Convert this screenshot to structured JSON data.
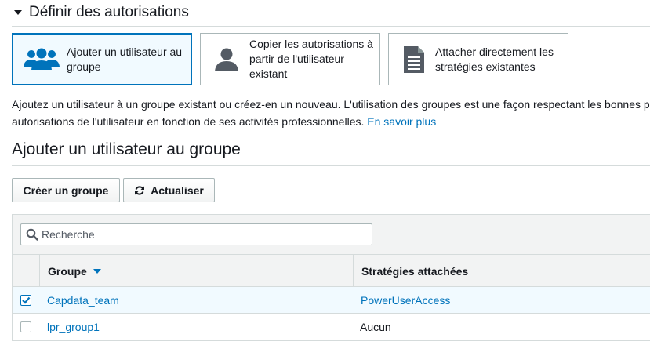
{
  "section": {
    "title": "Définir des autorisations"
  },
  "options": [
    {
      "label": "Ajouter un utilisateur au groupe",
      "icon": "users-group-icon",
      "selected": true
    },
    {
      "label": "Copier les autorisations à partir de l'utilisateur existant",
      "icon": "user-icon",
      "selected": false
    },
    {
      "label": "Attacher directement les stratégies existantes",
      "icon": "document-icon",
      "selected": false
    }
  ],
  "description": {
    "line1": "Ajoutez un utilisateur à un groupe existant ou créez-en un nouveau. L'utilisation des groupes est une façon respectant les bonnes p",
    "line2": "autorisations de l'utilisateur en fonction de ses activités professionnelles.",
    "link": "En savoir plus"
  },
  "subsection": {
    "title": "Ajouter un utilisateur au groupe"
  },
  "buttons": {
    "create": "Créer un groupe",
    "refresh": "Actualiser"
  },
  "search": {
    "placeholder": "Recherche",
    "value": ""
  },
  "table": {
    "headers": {
      "group": "Groupe",
      "policies": "Stratégies attachées"
    },
    "rows": [
      {
        "group": "Capdata_team",
        "policies": "PowerUserAccess",
        "checked": true
      },
      {
        "group": "lpr_group1",
        "policies": "Aucun",
        "checked": false
      }
    ]
  },
  "colors": {
    "accent": "#0073bb",
    "border": "#aab7b8",
    "header_bg": "#f2f3f3",
    "selected_bg": "#f1faff"
  }
}
